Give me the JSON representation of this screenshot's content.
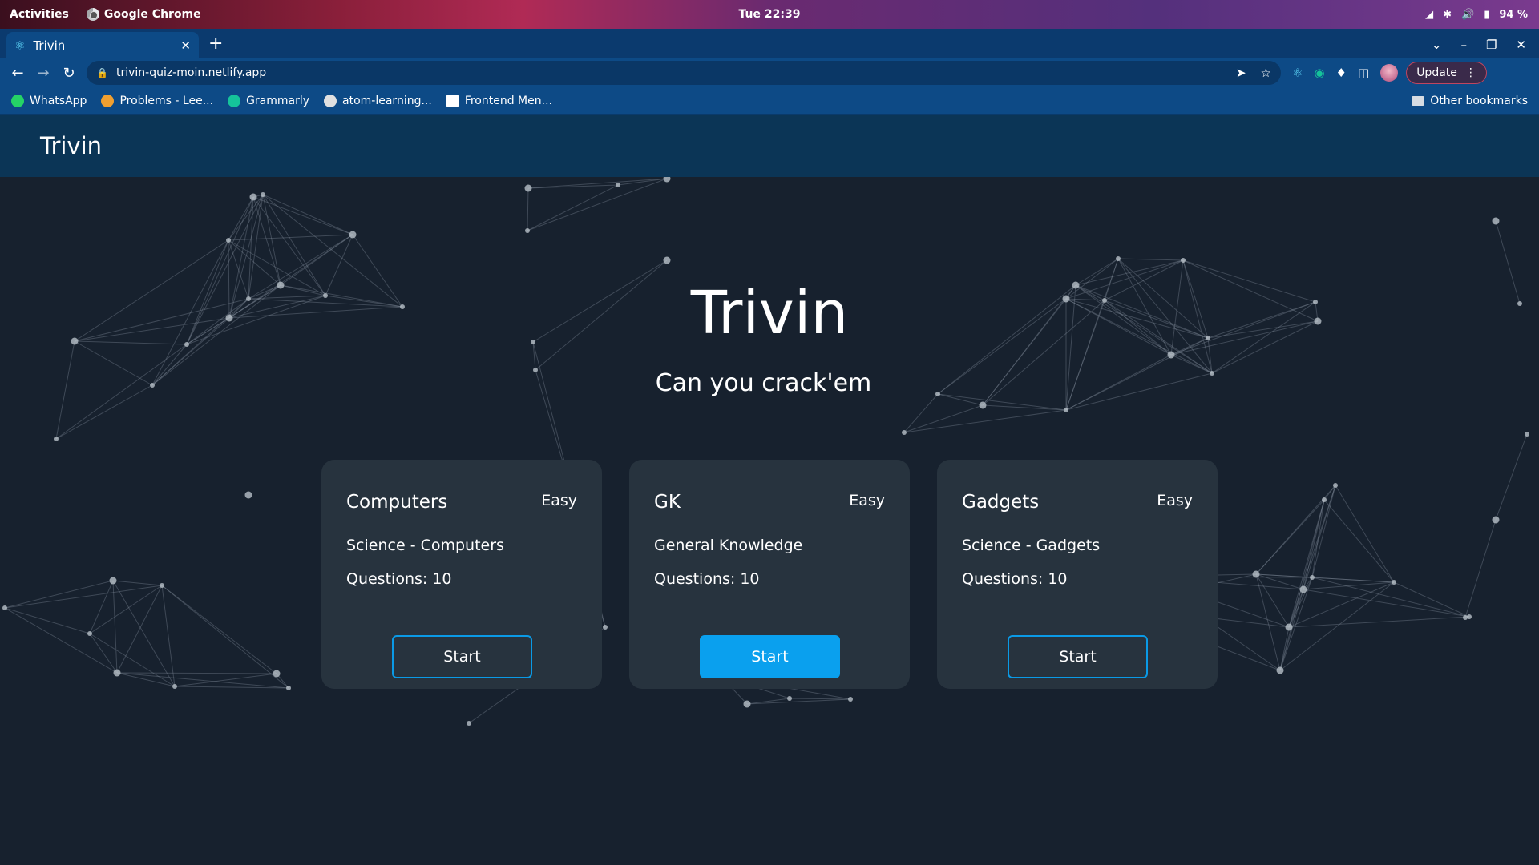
{
  "os": {
    "activities": "Activities",
    "app_name": "Google Chrome",
    "clock": "Tue 22:39",
    "battery": "94 %"
  },
  "browser": {
    "tab_title": "Trivin",
    "url": "trivin-quiz-moin.netlify.app",
    "update_label": "Update",
    "bookmarks": [
      {
        "label": "WhatsApp",
        "color": "#25d366"
      },
      {
        "label": "Problems - Lee...",
        "color": "#f0a030"
      },
      {
        "label": "Grammarly",
        "color": "#15c39a"
      },
      {
        "label": "atom-learning...",
        "color": "#e0e0e0"
      },
      {
        "label": "Frontend Men...",
        "color": "#ffffff"
      }
    ],
    "other_bookmarks": "Other bookmarks"
  },
  "app": {
    "brand": "Trivin",
    "hero_title": "Trivin",
    "hero_subtitle": "Can you crack'em",
    "accent": "#0aa0ee",
    "cards": [
      {
        "name": "Computers",
        "level": "Easy",
        "category": "Science - Computers",
        "questions": "Questions: 10",
        "start": "Start"
      },
      {
        "name": "GK",
        "level": "Easy",
        "category": "General Knowledge",
        "questions": "Questions: 10",
        "start": "Start"
      },
      {
        "name": "Gadgets",
        "level": "Easy",
        "category": "Science - Gadgets",
        "questions": "Questions: 10",
        "start": "Start"
      }
    ]
  }
}
